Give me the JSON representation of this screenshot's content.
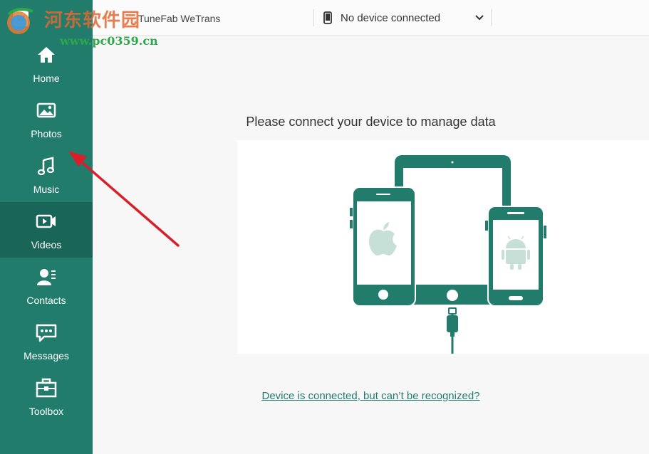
{
  "app": {
    "title": "TuneFab WeTrans"
  },
  "device": {
    "selected": "No device connected"
  },
  "sidebar": {
    "items": [
      {
        "label": "Home",
        "icon": "home-icon"
      },
      {
        "label": "Photos",
        "icon": "image-icon"
      },
      {
        "label": "Music",
        "icon": "music-note-icon"
      },
      {
        "label": "Videos",
        "icon": "video-icon",
        "active": true
      },
      {
        "label": "Contacts",
        "icon": "contacts-icon"
      },
      {
        "label": "Messages",
        "icon": "chat-icon"
      },
      {
        "label": "Toolbox",
        "icon": "toolbox-icon"
      }
    ]
  },
  "main": {
    "prompt": "Please connect your device to manage data",
    "help_link": "Device is connected, but can’t be recognized?"
  },
  "watermark": {
    "site_name": "河东软件园",
    "url": "www.pc0359.cn"
  },
  "colors": {
    "accent": "#227c6c",
    "accent_dark": "#196658",
    "device_screen": "#ffffff",
    "arrow": "#d9202a"
  }
}
